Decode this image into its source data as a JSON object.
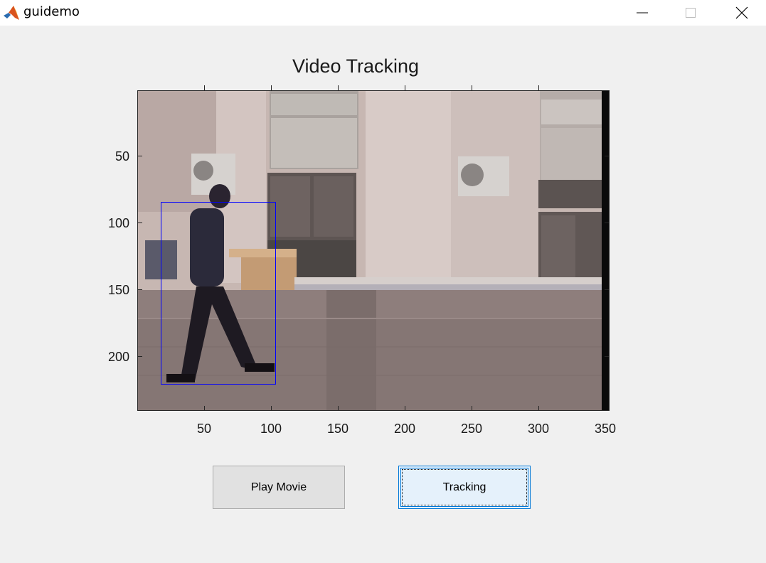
{
  "window": {
    "title": "guidemo",
    "icon": "matlab-icon",
    "controls": [
      "minimize-icon",
      "maximize-icon",
      "close-icon"
    ]
  },
  "axes": {
    "title": "Video Tracking",
    "x_ticks": [
      "50",
      "100",
      "150",
      "200",
      "250",
      "300",
      "350"
    ],
    "y_ticks": [
      "50",
      "100",
      "150",
      "200"
    ],
    "xlim": [
      0,
      352
    ],
    "ylim": [
      0,
      240
    ],
    "tracking_box": {
      "x_range": [
        17,
        103
      ],
      "y_range": [
        83,
        220
      ],
      "color": "#0000ff"
    },
    "content": "video-frame"
  },
  "buttons": {
    "play_label": "Play Movie",
    "tracking_label": "Tracking"
  },
  "colors": {
    "background": "#f0f0f0",
    "focus_border": "#0078d7",
    "focus_fill": "#e5f1fb"
  }
}
